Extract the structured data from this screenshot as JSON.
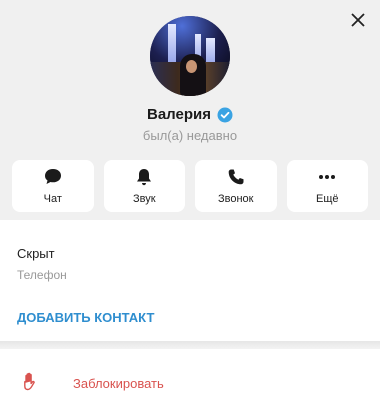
{
  "profile": {
    "name": "Валерия",
    "status": "был(а) недавно",
    "verified": true
  },
  "actions": [
    {
      "label": "Чат",
      "icon": "chat-icon"
    },
    {
      "label": "Звук",
      "icon": "bell-icon"
    },
    {
      "label": "Звонок",
      "icon": "phone-icon"
    },
    {
      "label": "Ещё",
      "icon": "more-icon"
    }
  ],
  "info": {
    "phone_value": "Скрыт",
    "phone_label": "Телефон",
    "add_contact": "ДОБАВИТЬ КОНТАКТ"
  },
  "block": {
    "label": "Заблокировать",
    "icon": "hand-icon"
  },
  "colors": {
    "accent": "#2f8ecf",
    "danger": "#d9534f",
    "verified": "#3aa3e3",
    "header_bg": "#f0f0f0"
  }
}
